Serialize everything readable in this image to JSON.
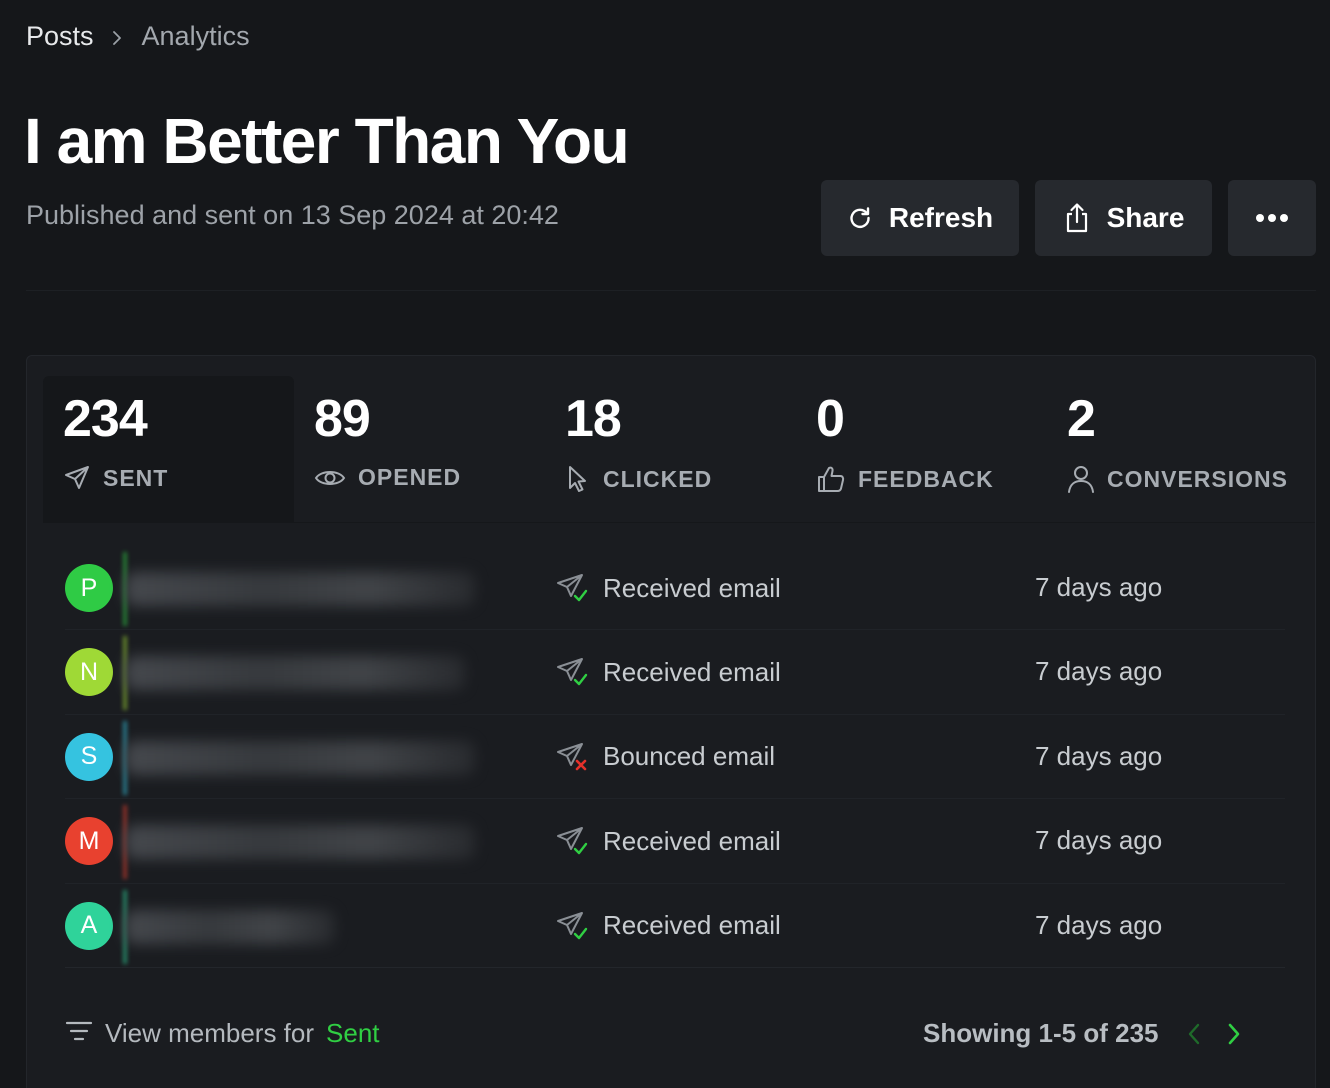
{
  "breadcrumb": {
    "parent": "Posts",
    "current": "Analytics"
  },
  "post": {
    "title": "I am Better Than You",
    "subtitle": "Published and sent on 13 Sep 2024 at 20:42"
  },
  "actions": {
    "refresh": "Refresh",
    "share": "Share",
    "more": "more-icon"
  },
  "tabs": [
    {
      "value": "234",
      "label": "SENT",
      "icon": "send-icon"
    },
    {
      "value": "89",
      "label": "OPENED",
      "icon": "eye-icon"
    },
    {
      "value": "18",
      "label": "CLICKED",
      "icon": "cursor-icon"
    },
    {
      "value": "0",
      "label": "FEEDBACK",
      "icon": "thumbs-up-icon"
    },
    {
      "value": "2",
      "label": "CONVERSIONS",
      "icon": "user-icon"
    }
  ],
  "rows": [
    {
      "initial": "P",
      "avatar_color": "#2fcb45",
      "status": "Received email",
      "status_type": "received",
      "time": "7 days ago"
    },
    {
      "initial": "N",
      "avatar_color": "#9fd936",
      "status": "Received email",
      "status_type": "received",
      "time": "7 days ago"
    },
    {
      "initial": "S",
      "avatar_color": "#35c3e0",
      "status": "Bounced email",
      "status_type": "bounced",
      "time": "7 days ago"
    },
    {
      "initial": "M",
      "avatar_color": "#e8412f",
      "status": "Received email",
      "status_type": "received",
      "time": "7 days ago"
    },
    {
      "initial": "A",
      "avatar_color": "#2fd39a",
      "status": "Received email",
      "status_type": "received",
      "time": "7 days ago"
    }
  ],
  "footer": {
    "view_members_prefix": "View members for",
    "view_members_filter": "Sent",
    "showing": "Showing 1-5 of 235"
  },
  "colors": {
    "accent": "#30cf43",
    "bounce": "#e5312a"
  }
}
